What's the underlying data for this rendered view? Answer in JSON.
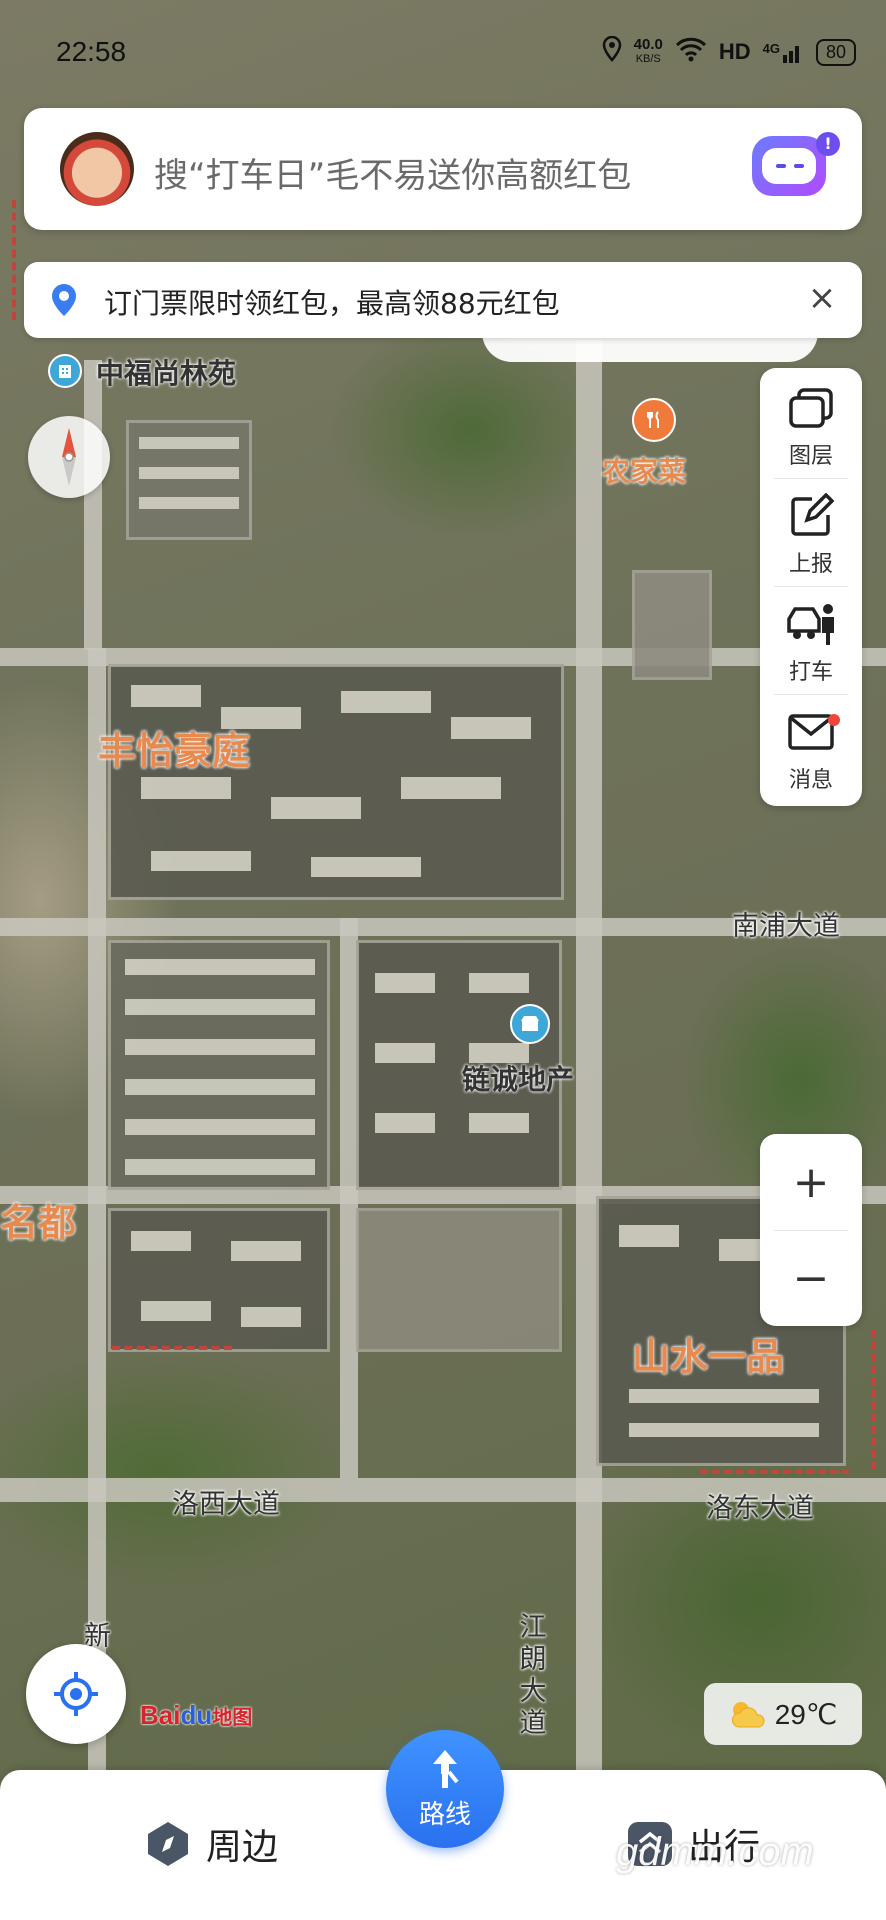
{
  "status_bar": {
    "time": "22:58",
    "speed_value": "40.0",
    "speed_unit": "KB/S",
    "hd": "HD",
    "network": "4G",
    "battery": "80"
  },
  "search": {
    "placeholder": "搜“打车日”毛不易送你高额红包",
    "assistant_badge": "!"
  },
  "promo": {
    "text": "订门票限时领红包，最高领88元红包",
    "close": "×"
  },
  "toolbar": {
    "layers": "图层",
    "report": "上报",
    "taxi": "打车",
    "messages": "消息"
  },
  "zoom": {
    "in": "+",
    "out": "−"
  },
  "map_labels": {
    "zhongfu": "中福尚林苑",
    "nongjiacai": "农家菜",
    "fengyi": "丰怡豪庭",
    "liancheng": "链诚地产",
    "mingdu": "名都",
    "shanshui": "山水一品",
    "nanpu": "南浦大道",
    "luoxi": "洛西大道",
    "luodong": "洛东大道",
    "jianglang": "江朗大道",
    "xin": "新"
  },
  "weather": {
    "temp": "29℃",
    "icon": "partly-cloudy-icon"
  },
  "logo": {
    "bai": "Bai",
    "du": "du",
    "ditu": "地图"
  },
  "bottom_nav": {
    "nearby": "周边",
    "route": "路线",
    "travel": "出行"
  },
  "watermark": "gdmm.com",
  "colors": {
    "accent": "#2a71f0",
    "label_orange": "#e78a50",
    "badge_red": "#f0463a"
  }
}
